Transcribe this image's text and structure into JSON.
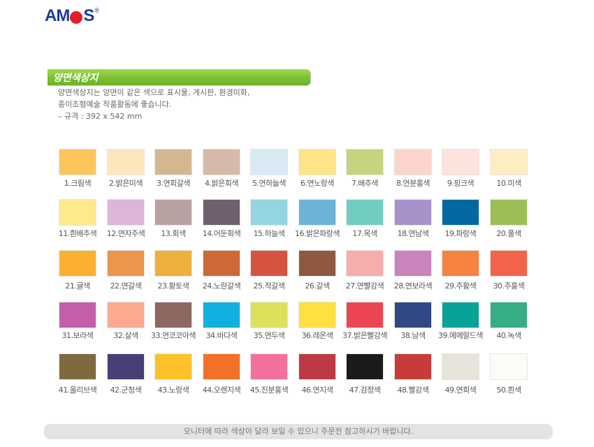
{
  "brand": {
    "logo_pre": "AM",
    "logo_post": "S",
    "logo_reg": "®"
  },
  "section": {
    "title": "양면색상지"
  },
  "description": {
    "line1": "양면색상지는 양면이 같은 색으로 표시물, 게시판, 환경미화,",
    "line2": "종이조형예술 작품활동에 좋습니다.",
    "line3": "– 규격 : 392 x 542 mm"
  },
  "colors": [
    {
      "label": "1.크림색",
      "hex": "#fcc65c"
    },
    {
      "label": "2.밝은미색",
      "hex": "#fde6be"
    },
    {
      "label": "3.연회갈색",
      "hex": "#d2b791"
    },
    {
      "label": "4.밝은회색",
      "hex": "#d7b9aa"
    },
    {
      "label": "5.연하늘색",
      "hex": "#d8eaf4"
    },
    {
      "label": "6.연노랑색",
      "hex": "#fde486"
    },
    {
      "label": "7.배추색",
      "hex": "#c4d57d"
    },
    {
      "label": "8.연분홍색",
      "hex": "#fbd5cb"
    },
    {
      "label": "9.핑크색",
      "hex": "#fde3db"
    },
    {
      "label": "10.미색",
      "hex": "#fdeec2"
    },
    {
      "label": "11.흰배추색",
      "hex": "#fee98d"
    },
    {
      "label": "12.연자주색",
      "hex": "#dcb6d8"
    },
    {
      "label": "13.회색",
      "hex": "#b8a2a1"
    },
    {
      "label": "14.어둔회색",
      "hex": "#6f5f6f"
    },
    {
      "label": "15.하늘색",
      "hex": "#95d5e1"
    },
    {
      "label": "16.밝은파랑색",
      "hex": "#6cb3d7"
    },
    {
      "label": "17.옥색",
      "hex": "#6fcec0"
    },
    {
      "label": "18.연남색",
      "hex": "#a890c9"
    },
    {
      "label": "19.파랑색",
      "hex": "#0468a2"
    },
    {
      "label": "20.풀색",
      "hex": "#9cbf55"
    },
    {
      "label": "21.귤색",
      "hex": "#fbb12f"
    },
    {
      "label": "22.연갈색",
      "hex": "#ec954c"
    },
    {
      "label": "23.황토색",
      "hex": "#eeb03c"
    },
    {
      "label": "24.노란갈색",
      "hex": "#ce6834"
    },
    {
      "label": "25.적갈색",
      "hex": "#d55441"
    },
    {
      "label": "26.갈색",
      "hex": "#8f5840"
    },
    {
      "label": "27.연빨강색",
      "hex": "#f7adad"
    },
    {
      "label": "28.연보라색",
      "hex": "#c984be"
    },
    {
      "label": "29.주황색",
      "hex": "#f68340"
    },
    {
      "label": "30.주홍색",
      "hex": "#f3634a"
    },
    {
      "label": "31.보라색",
      "hex": "#c45eab"
    },
    {
      "label": "32.살색",
      "hex": "#fbaa90"
    },
    {
      "label": "33.연코코아색",
      "hex": "#8c6860"
    },
    {
      "label": "34.바다색",
      "hex": "#12b0e0"
    },
    {
      "label": "35.연두색",
      "hex": "#dce15c"
    },
    {
      "label": "36.레몬색",
      "hex": "#ffe042"
    },
    {
      "label": "37.밝은빨강색",
      "hex": "#ec4654"
    },
    {
      "label": "38.남색",
      "hex": "#314886"
    },
    {
      "label": "39.에메랄드색",
      "hex": "#07a398"
    },
    {
      "label": "40.녹색",
      "hex": "#36ae83"
    },
    {
      "label": "41.올리브색",
      "hex": "#7f6a40"
    },
    {
      "label": "42.군청색",
      "hex": "#483f77"
    },
    {
      "label": "43.노랑색",
      "hex": "#fdc22a"
    },
    {
      "label": "44.오렌지색",
      "hex": "#f27126"
    },
    {
      "label": "45.진분홍색",
      "hex": "#f3709a"
    },
    {
      "label": "46.연지색",
      "hex": "#bd3a44"
    },
    {
      "label": "47.검정색",
      "hex": "#1c191a"
    },
    {
      "label": "48.빨강색",
      "hex": "#c83b3b"
    },
    {
      "label": "49.연회색",
      "hex": "#e6e4d8"
    },
    {
      "label": "50.흰색",
      "hex": "#fcfbf5"
    }
  ],
  "footer": {
    "notice": "모니터에 따라 색상이 달라 보일 수 있으니 주문전 참고하시기 바랍니다."
  }
}
